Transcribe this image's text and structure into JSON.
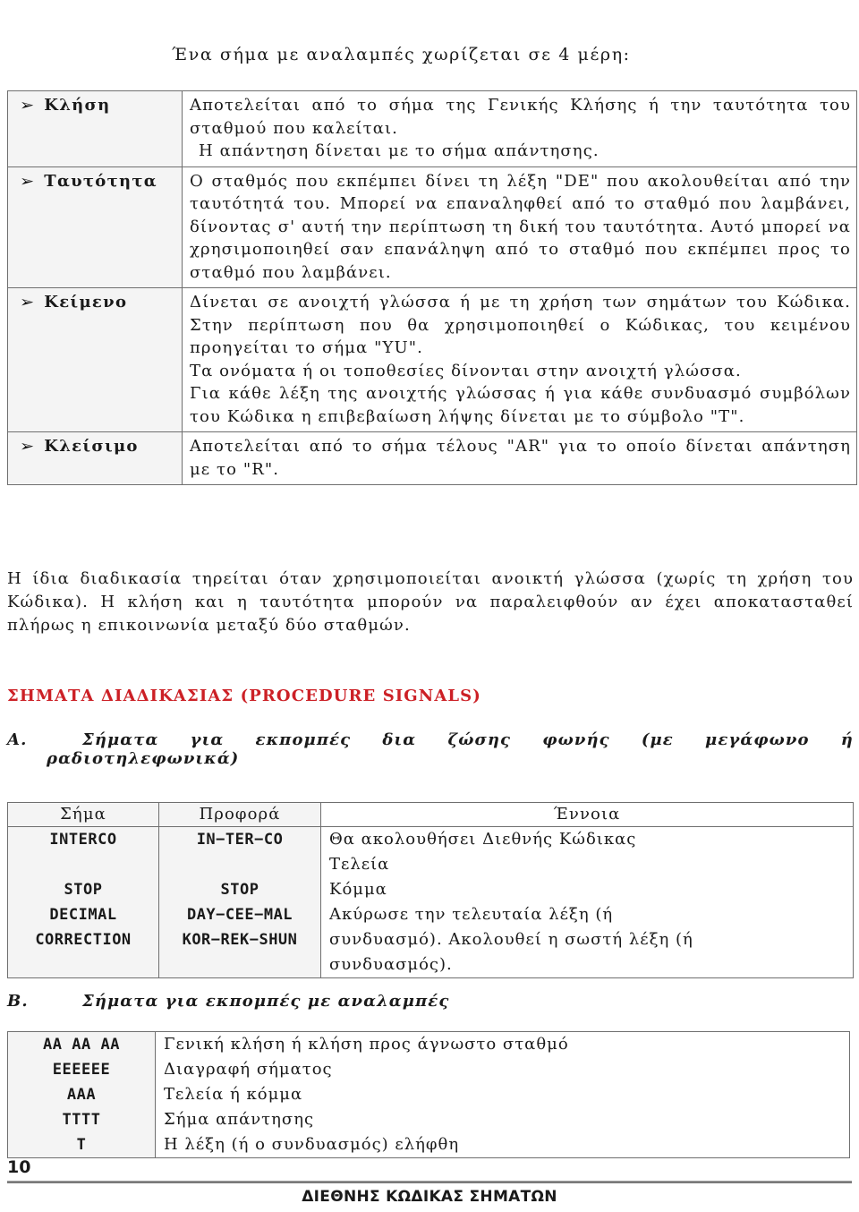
{
  "intro": {
    "title": "Ένα σήμα με αναλαμπές χωρίζεται σε 4 μέρη:"
  },
  "parts_table": {
    "bullet_glyph": "➢",
    "rows": [
      {
        "label": "Κλήση",
        "paragraphs": [
          "Αποτελείται από το σήμα της Γενικής Κλήσης ή την ταυτότητα του σταθμού που καλείται.",
          "Η απάντηση δίνεται με το σήμα απάντησης."
        ]
      },
      {
        "label": "Ταυτότητα",
        "paragraphs": [
          "Ο σταθμός που εκπέμπει δίνει τη λέξη \"DE\" που ακολουθείται από την ταυτότητά του. Μπορεί να επαναληφθεί από το σταθμό που λαμβάνει, δίνοντας σ' αυτή την περίπτωση τη δική του ταυτότητα. Αυτό μπορεί να χρησιμοποιηθεί σαν επανάληψη από το σταθμό που εκπέμπει προς το σταθμό που λαμβάνει."
        ]
      },
      {
        "label": "Κείμενο",
        "paragraphs": [
          "Δίνεται σε ανοιχτή γλώσσα ή με τη χρήση των σημάτων του Κώδικα. Στην περίπτωση που θα χρησιμοποιηθεί ο Κώδικας, του κειμένου προηγείται το σήμα \"ΥU\".",
          "Τα ονόματα ή οι τοποθεσίες δίνονται στην ανοιχτή γλώσσα.",
          "Για κάθε λέξη της ανοιχτής γλώσσας ή για κάθε συνδυασμό συμβόλων του Κώδικα η επιβεβαίωση λήψης δίνεται με το σύμβολο \"Τ\"."
        ]
      },
      {
        "label": "Κλείσιμο",
        "paragraphs": [
          "Αποτελείται από το σήμα τέλους \"AR\" για το οποίο δίνεται απάντηση με το \"R\"."
        ]
      }
    ]
  },
  "free_paragraph": "Η ίδια διαδικασία τηρείται όταν χρησιμοποιείται ανοικτή γλώσσα (χωρίς τη χρήση του Κώδικα). Η κλήση και η ταυτότητα μπορούν να παραλειφθούν αν έχει αποκατασταθεί πλήρως η επικοινωνία μεταξύ δύο σταθμών.",
  "red_heading": "ΣΗΜΑΤΑ ΔΙΑΔΙΚΑΣΙΑΣ (PROCEDURE SIGNALS)",
  "red_heading_color": "#cc2026",
  "section_a": {
    "letter": "Α.",
    "title_line1": "Σήματα για εκπομπές δια ζώσης φωνής (με μεγάφωνο ή",
    "title_line2": "ραδιοτηλεφωνικά)",
    "table": {
      "headers": [
        "Σήμα",
        "Προφορά",
        "Έννοια"
      ],
      "signal_lines": [
        "INTERCO",
        "",
        "STOP",
        "DECIMAL",
        "CORRECTION"
      ],
      "pronunciation_lines": [
        "IN−TER−CO",
        "",
        "STOP",
        "DAY−CEE−MAL",
        "KOR−REK−SHUN"
      ],
      "meaning_lines": [
        "Θα ακολουθήσει  Διεθνής Κώδικας",
        "Τελεία",
        "Κόμμα",
        "Ακύρωσε την τελευταία λέξη (ή",
        "συνδυασμό). Ακολουθεί η σωστή λέξη (ή",
        "συνδυασμός)."
      ]
    }
  },
  "section_b": {
    "letter": "Β.",
    "title": "Σήματα για εκπομπές με αναλαμπές",
    "table": {
      "code_lines": [
        "ΑΑ  ΑΑ  ΑΑ",
        "ΕΕΕΕΕΕ",
        "ΑΑΑ",
        "ΤΤΤΤ",
        "Τ"
      ],
      "description_lines": [
        "Γενική κλήση ή κλήση προς άγνωστο σταθμό",
        "Διαγραφή σήματος",
        "Τελεία ή κόμμα",
        "Σήμα απάντησης",
        "Η λέξη (ή ο συνδυασμός) ελήφθη"
      ]
    }
  },
  "footer": {
    "page_number": "10",
    "title": "ΔΙΕΘΝΗΣ ΚΩΔΙΚΑΣ ΣΗΜΑΤΩΝ"
  }
}
